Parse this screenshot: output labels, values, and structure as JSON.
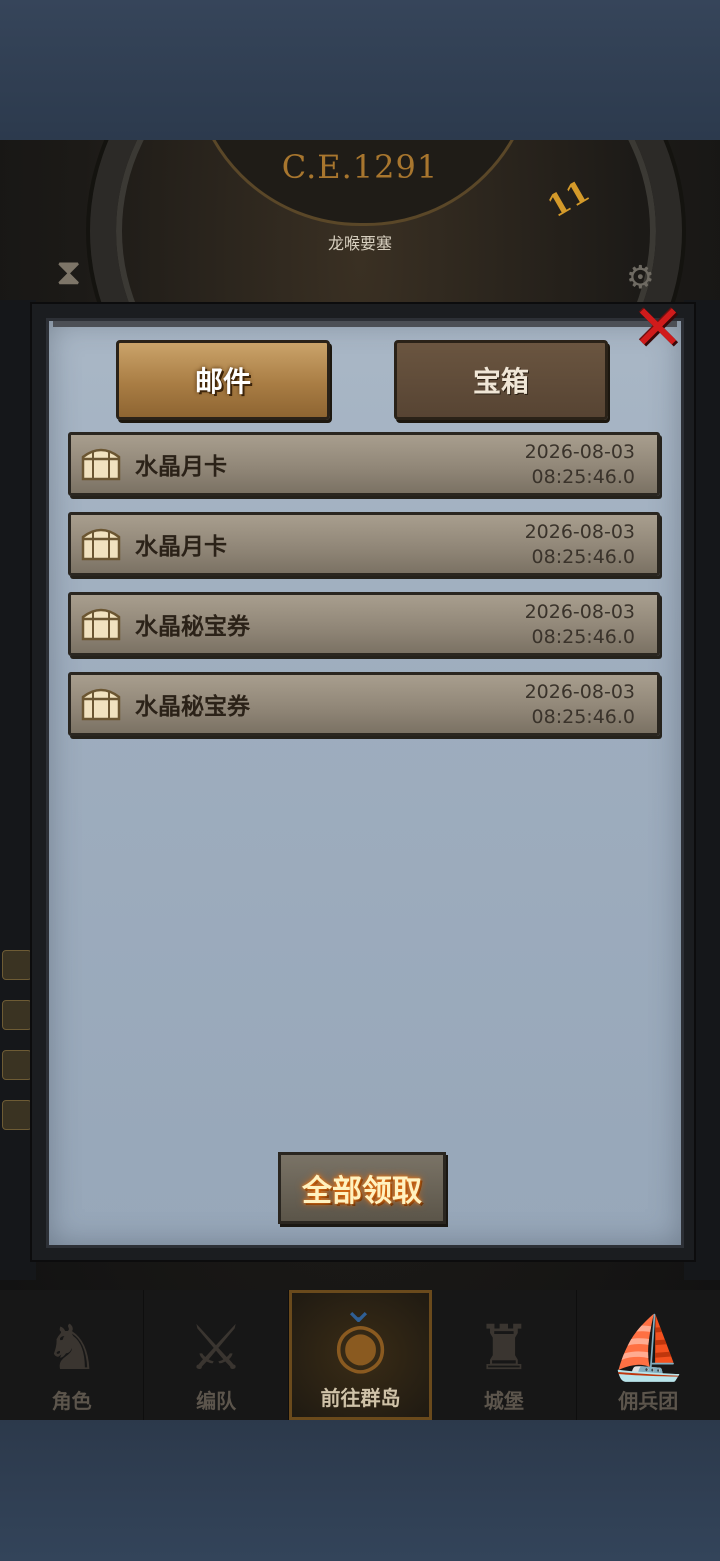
{
  "header": {
    "year": "C.E.1291",
    "location": "龙喉要塞",
    "hour": "11"
  },
  "tabs": [
    {
      "label": "邮件",
      "active": true
    },
    {
      "label": "宝箱",
      "active": false
    }
  ],
  "mails": [
    {
      "title": "水晶月卡",
      "date": "2026-08-03",
      "time": "08:25:46.0",
      "icon": "treasure-chest-icon"
    },
    {
      "title": "水晶月卡",
      "date": "2026-08-03",
      "time": "08:25:46.0",
      "icon": "treasure-chest-icon"
    },
    {
      "title": "水晶秘宝券",
      "date": "2026-08-03",
      "time": "08:25:46.0",
      "icon": "treasure-chest-icon"
    },
    {
      "title": "水晶秘宝券",
      "date": "2026-08-03",
      "time": "08:25:46.0",
      "icon": "treasure-chest-icon"
    }
  ],
  "claim_all_label": "全部领取",
  "nav": [
    {
      "label": "角色",
      "icon": "knight-icon",
      "active": false
    },
    {
      "label": "编队",
      "icon": "formation-icon",
      "active": false
    },
    {
      "label": "前往群岛",
      "icon": "compass-globe-icon",
      "active": true
    },
    {
      "label": "城堡",
      "icon": "castle-icon",
      "active": false
    },
    {
      "label": "佣兵团",
      "icon": "ship-icon",
      "active": false
    }
  ],
  "colors": {
    "accent": "#d01b1b",
    "tab_active": "#b58a50",
    "paper": "#a3b2c2"
  }
}
